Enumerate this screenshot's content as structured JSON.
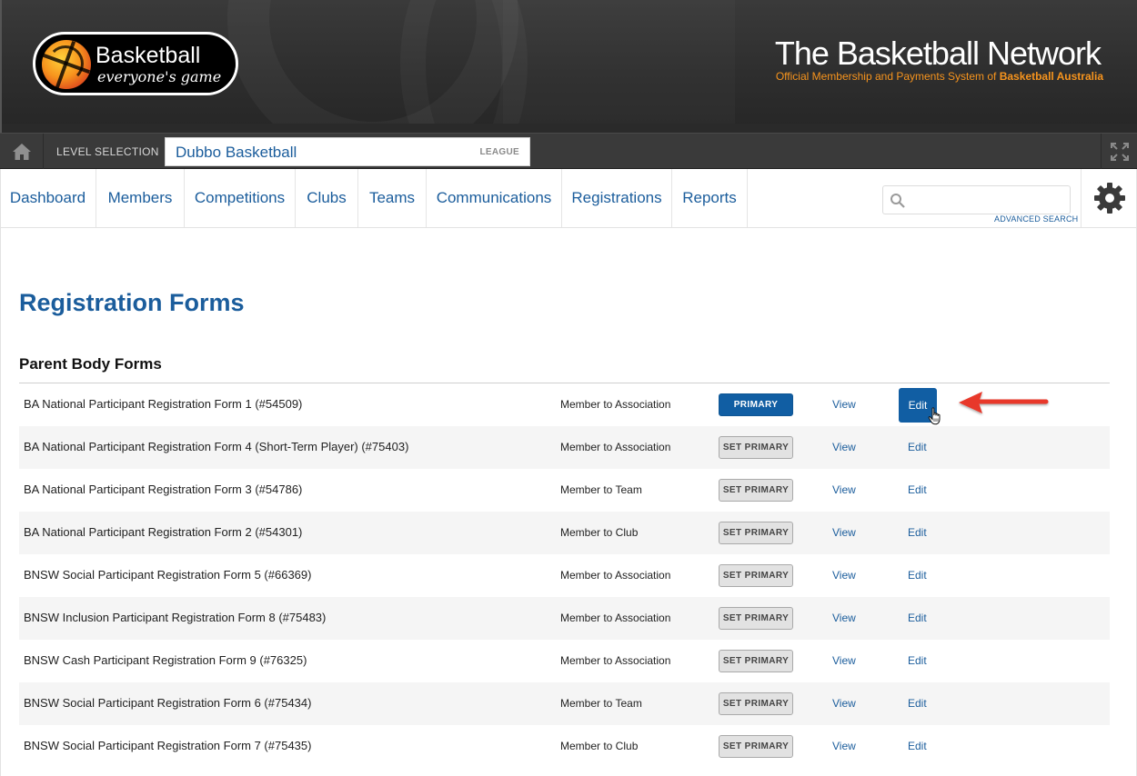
{
  "header": {
    "logo_word": "Basketball",
    "logo_tagline": "everyone's game",
    "network_title": "The Basketball Network",
    "network_sub_prefix": "Official Membership and Payments System of",
    "network_sub_strong": "Basketball Australia"
  },
  "level": {
    "label": "LEVEL SELECTION",
    "value": "Dubbo Basketball",
    "tag": "LEAGUE"
  },
  "nav": {
    "items": [
      {
        "label": "Dashboard"
      },
      {
        "label": "Members"
      },
      {
        "label": "Competitions"
      },
      {
        "label": "Clubs"
      },
      {
        "label": "Teams"
      },
      {
        "label": "Communications"
      },
      {
        "label": "Registrations"
      },
      {
        "label": "Reports"
      }
    ],
    "search_placeholder": "",
    "advanced_search": "ADVANCED SEARCH"
  },
  "page": {
    "title": "Registration Forms",
    "section_title": "Parent Body Forms"
  },
  "forms": [
    {
      "name": "BA National Participant Registration Form 1 (#54509)",
      "type": "Member to Association",
      "primary_label": "PRIMARY",
      "is_primary": true,
      "view": "View",
      "edit": "Edit"
    },
    {
      "name": "BA National Participant Registration Form 4 (Short-Term Player) (#75403)",
      "type": "Member to Association",
      "primary_label": "SET PRIMARY",
      "is_primary": false,
      "view": "View",
      "edit": "Edit"
    },
    {
      "name": "BA National Participant Registration Form 3 (#54786)",
      "type": "Member to Team",
      "primary_label": "SET PRIMARY",
      "is_primary": false,
      "view": "View",
      "edit": "Edit"
    },
    {
      "name": "BA National Participant Registration Form 2 (#54301)",
      "type": "Member to Club",
      "primary_label": "SET PRIMARY",
      "is_primary": false,
      "view": "View",
      "edit": "Edit"
    },
    {
      "name": "BNSW Social Participant Registration Form 5 (#66369)",
      "type": "Member to Association",
      "primary_label": "SET PRIMARY",
      "is_primary": false,
      "view": "View",
      "edit": "Edit"
    },
    {
      "name": "BNSW Inclusion Participant Registration Form 8 (#75483)",
      "type": "Member to Association",
      "primary_label": "SET PRIMARY",
      "is_primary": false,
      "view": "View",
      "edit": "Edit"
    },
    {
      "name": "BNSW Cash Participant Registration Form 9 (#76325)",
      "type": "Member to Association",
      "primary_label": "SET PRIMARY",
      "is_primary": false,
      "view": "View",
      "edit": "Edit"
    },
    {
      "name": "BNSW Social Participant Registration Form 6 (#75434)",
      "type": "Member to Team",
      "primary_label": "SET PRIMARY",
      "is_primary": false,
      "view": "View",
      "edit": "Edit"
    },
    {
      "name": "BNSW Social Participant Registration Form 7 (#75435)",
      "type": "Member to Club",
      "primary_label": "SET PRIMARY",
      "is_primary": false,
      "view": "View",
      "edit": "Edit"
    }
  ],
  "colors": {
    "link_blue": "#1b5d9c",
    "primary_button": "#115ea3",
    "brand_orange": "#f7941d",
    "annotation_arrow": "#e8382b"
  },
  "icons": [
    "home-icon",
    "expand-icon",
    "search-icon",
    "gear-icon",
    "arrow-annotation-icon",
    "hand-cursor-icon"
  ]
}
